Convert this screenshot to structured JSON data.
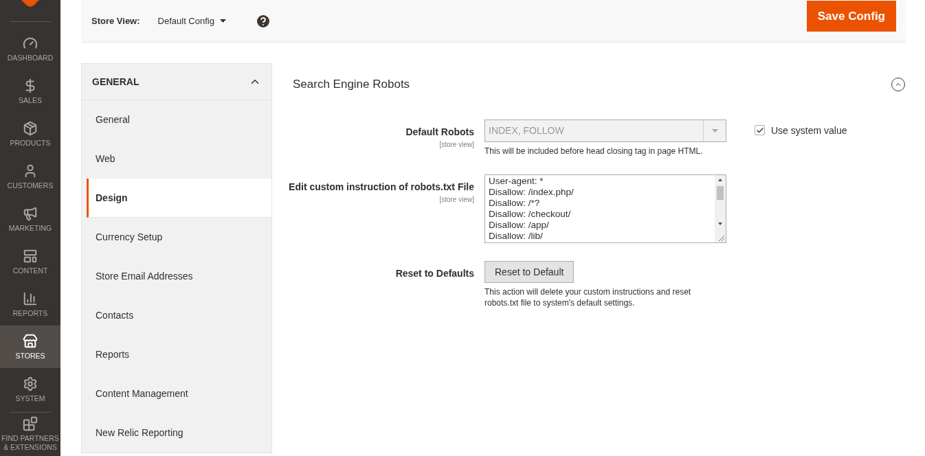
{
  "nav": {
    "items": [
      {
        "label": "DASHBOARD",
        "kind": "dashboard",
        "selected": false
      },
      {
        "label": "SALES",
        "kind": "sales",
        "selected": false
      },
      {
        "label": "PRODUCTS",
        "kind": "products",
        "selected": false
      },
      {
        "label": "CUSTOMERS",
        "kind": "customers",
        "selected": false
      },
      {
        "label": "MARKETING",
        "kind": "marketing",
        "selected": false
      },
      {
        "label": "CONTENT",
        "kind": "content",
        "selected": false
      },
      {
        "label": "REPORTS",
        "kind": "reports",
        "selected": false
      },
      {
        "label": "STORES",
        "kind": "stores",
        "selected": true
      },
      {
        "label": "SYSTEM",
        "kind": "system",
        "selected": false
      },
      {
        "label": "FIND PARTNERS & EXTENSIONS",
        "kind": "partners",
        "selected": false
      }
    ]
  },
  "header": {
    "store_view_label": "Store View:",
    "store_view_value": "Default Config",
    "save_button": "Save Config"
  },
  "config_tabs": {
    "title": "GENERAL",
    "expanded": true,
    "items": [
      {
        "label": "General",
        "selected": false
      },
      {
        "label": "Web",
        "selected": false
      },
      {
        "label": "Design",
        "selected": true
      },
      {
        "label": "Currency Setup",
        "selected": false
      },
      {
        "label": "Store Email Addresses",
        "selected": false
      },
      {
        "label": "Contacts",
        "selected": false
      },
      {
        "label": "Reports",
        "selected": false
      },
      {
        "label": "Content Management",
        "selected": false
      },
      {
        "label": "New Relic Reporting",
        "selected": false
      }
    ]
  },
  "section": {
    "title": "Search Engine Robots",
    "expanded": true,
    "fields": [
      {
        "kind": "select",
        "label": "Default Robots",
        "scope": "[store view]",
        "value": "INDEX, FOLLOW",
        "disabled": true,
        "note": "This will be included before head closing tag in page HTML.",
        "use_system_value": {
          "label": "Use system value",
          "checked": true
        }
      },
      {
        "kind": "textarea",
        "label": "Edit custom instruction of robots.txt File",
        "scope": "[store view]",
        "lines": [
          "User-agent: *",
          "Disallow: /index.php/",
          "Disallow: /*?",
          "Disallow: /checkout/",
          "Disallow: /app/",
          "Disallow: /lib/"
        ]
      },
      {
        "kind": "button",
        "label": "Reset to Defaults",
        "button": "Reset to Default",
        "note": "This action will delete your custom instructions and reset robots.txt file to system's default settings."
      }
    ]
  }
}
